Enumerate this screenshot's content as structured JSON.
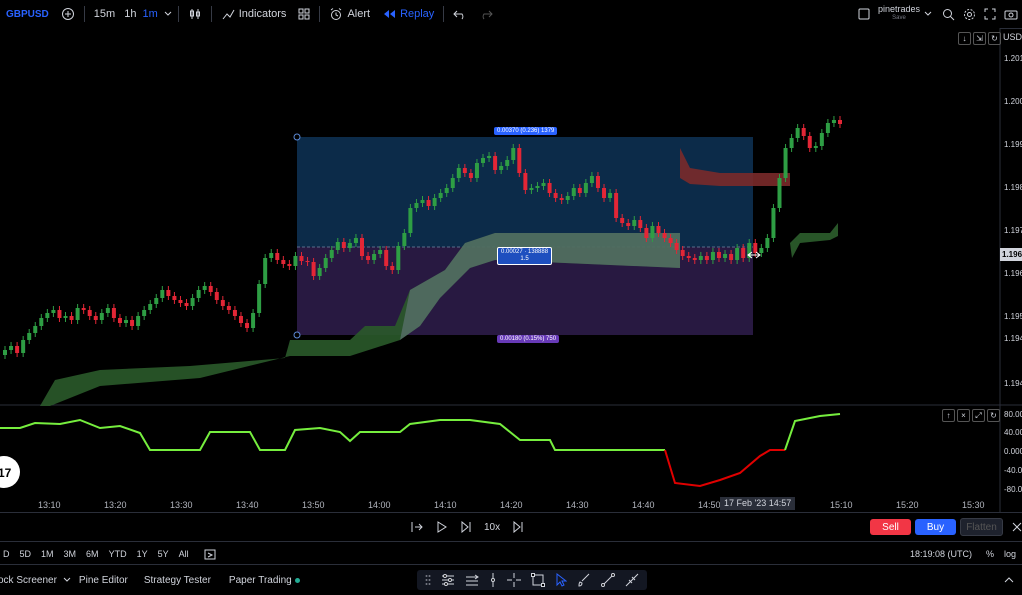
{
  "topbar": {
    "symbol": "GBPUSD",
    "intervals": [
      "15m",
      "1h",
      "1m"
    ],
    "indicators_label": "Indicators",
    "alert_label": "Alert",
    "replay_label": "Replay",
    "layout_name": "pinetrades",
    "layout_status": "Save",
    "currency": "USD"
  },
  "price_axis": [
    "1.201",
    "1.200",
    "1.199",
    "1.198",
    "1.197",
    "1.196",
    "1.195",
    "1.194",
    "1.194"
  ],
  "current_price": "1.196",
  "time_axis": [
    "13:10",
    "13:20",
    "13:30",
    "13:40",
    "13:50",
    "14:00",
    "14:10",
    "14:20",
    "14:30",
    "14:40",
    "14:50",
    "15:10",
    "15:20",
    "15:30"
  ],
  "time_highlight": "17 Feb '23   14:57",
  "oscillator_axis": [
    "80.00",
    "40.00",
    "0.000",
    "-40.00",
    "-80.00"
  ],
  "position": {
    "target_label": "0.00370 (0.236) 1379",
    "entry_label_1": "0.00027 · 138888",
    "entry_label_2": "1.5",
    "stop_label": "0.00180 (0.15%) 750"
  },
  "replay": {
    "speed": "10x",
    "sell_label": "Sell",
    "buy_label": "Buy",
    "flatten_label": "Flatten"
  },
  "ranges": [
    "D",
    "5D",
    "1M",
    "3M",
    "6M",
    "YTD",
    "1Y",
    "5Y",
    "All"
  ],
  "clock": "18:19:08 (UTC)",
  "scale_pct": "%",
  "scale_log": "log",
  "bottom_tabs": [
    "ock Screener",
    "Pine Editor",
    "Strategy Tester",
    "Paper Trading"
  ],
  "colors": {
    "bull": "#2e9e44",
    "bear": "#e32636",
    "cloud_green": "#2a5a2a",
    "target_zone": "#0d2d4d",
    "stop_zone": "#2a1a45",
    "osc_green": "#76ee3e",
    "osc_red": "#e00000",
    "sell": "#f23645",
    "buy": "#2962ff"
  }
}
